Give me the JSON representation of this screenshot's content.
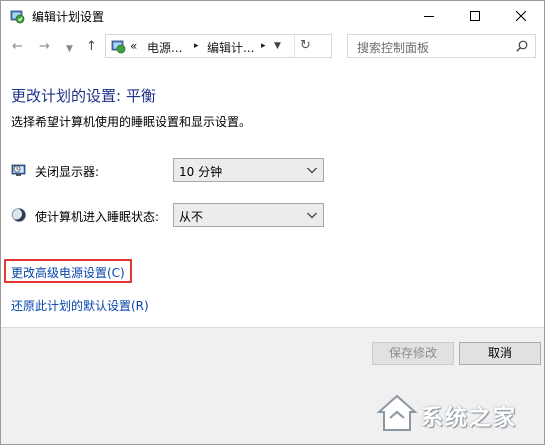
{
  "window": {
    "title": "编辑计划设置"
  },
  "nav": {
    "address_chevron": "«",
    "address_segments": [
      "电源...",
      "编辑计..."
    ],
    "search_placeholder": "搜索控制面板"
  },
  "main": {
    "heading": "更改计划的设置: 平衡",
    "subtitle": "选择希望计算机使用的睡眠设置和显示设置。",
    "settings": [
      {
        "label": "关闭显示器:",
        "value": "10 分钟",
        "icon": "monitor-clock-icon"
      },
      {
        "label": "使计算机进入睡眠状态:",
        "value": "从不",
        "icon": "moon-sleep-icon"
      }
    ],
    "links": {
      "advanced": "更改高级电源设置(C)",
      "restore": "还原此计划的默认设置(R)"
    }
  },
  "footer": {
    "save_label": "保存修改",
    "cancel_label": "取消"
  },
  "watermark": {
    "text": "系统之家"
  },
  "colors": {
    "heading": "#1e3287",
    "link": "#0645ad",
    "highlight": "#e53935"
  }
}
